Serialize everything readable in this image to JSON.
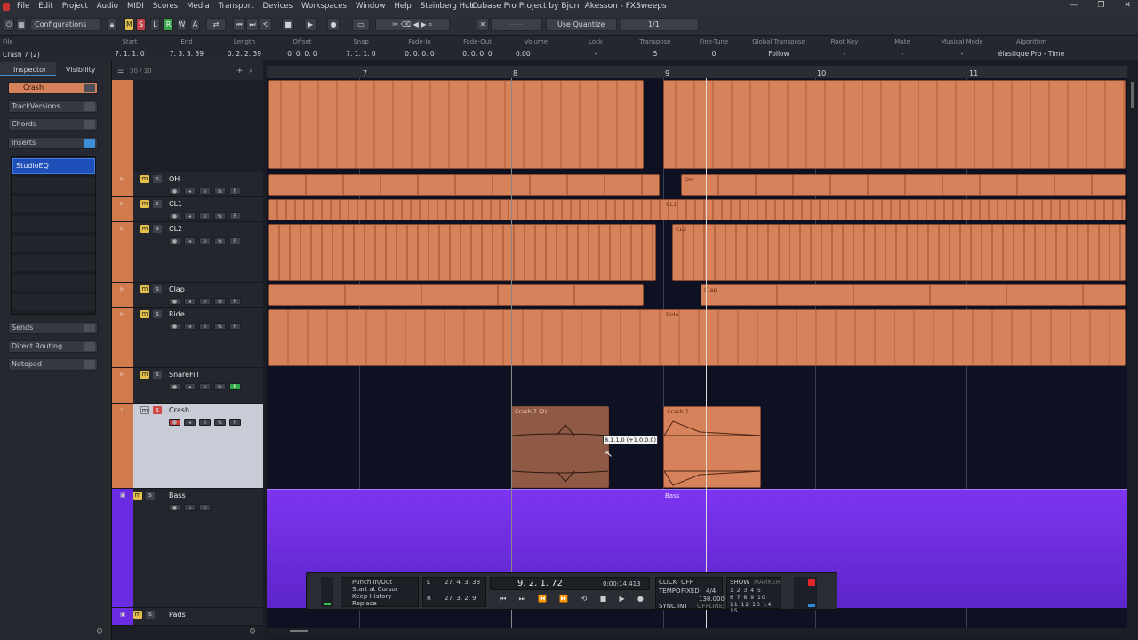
{
  "app": {
    "title": "Cubase Pro Project by Bjorn Akesson - FXSweeps"
  },
  "menu": [
    "File",
    "Edit",
    "Project",
    "Audio",
    "MIDI",
    "Scores",
    "Media",
    "Transport",
    "Devices",
    "Workspaces",
    "Window",
    "Help",
    "Steinberg Hub"
  ],
  "toolbar": {
    "configurations": "Configurations",
    "quantize": "Use Quantize",
    "grid": "1/1",
    "m": "M",
    "s": "S",
    "l": "L",
    "r": "R",
    "w": "W",
    "a": "A"
  },
  "infoline": {
    "selection": "Crash 7 (2)",
    "file_label": "File",
    "columns": [
      {
        "label": "Start",
        "value": "7. 1. 1. 0"
      },
      {
        "label": "End",
        "value": "7. 3. 3. 39"
      },
      {
        "label": "Length",
        "value": "0. 2. 2. 39"
      },
      {
        "label": "Offset",
        "value": "0. 0. 0. 0"
      },
      {
        "label": "Snap",
        "value": "7. 1. 1. 0"
      },
      {
        "label": "Fade-In",
        "value": "0. 0. 0. 0"
      },
      {
        "label": "Fade-Out",
        "value": "0. 0. 0. 0"
      },
      {
        "label": "Volume",
        "value": "0.00"
      },
      {
        "label": "Lock",
        "value": "-"
      },
      {
        "label": "Transpose",
        "value": "5"
      },
      {
        "label": "Fine-Tune",
        "value": "0"
      },
      {
        "label": "Global Transpose",
        "value": "Follow"
      },
      {
        "label": "Root Key",
        "value": "-"
      },
      {
        "label": "Mute",
        "value": "-"
      },
      {
        "label": "Musical Mode",
        "value": "-"
      },
      {
        "label": "Algorithm",
        "value": "élastique Pro - Time"
      }
    ]
  },
  "inspector": {
    "tab_inspector": "Inspector",
    "tab_visibility": "Visibility",
    "track_name": "Crash",
    "sections": [
      "TrackVersions",
      "Chords",
      "Inserts"
    ],
    "insert_slot": "StudioEQ",
    "lower_sections": [
      "Sends",
      "Direct Routing",
      "Notepad"
    ]
  },
  "tracklist": {
    "count": "30 / 30"
  },
  "tracks": [
    {
      "num": "3",
      "name": "OH"
    },
    {
      "num": "4",
      "name": "CL1"
    },
    {
      "num": "5",
      "name": "CL2"
    },
    {
      "num": "6",
      "name": "Clap"
    },
    {
      "num": "7",
      "name": "Ride"
    },
    {
      "num": "8",
      "name": "SnareFill"
    },
    {
      "num": "9",
      "name": "Crash"
    },
    {
      "num": "",
      "name": "Bass"
    },
    {
      "num": "",
      "name": "Pads"
    }
  ],
  "ruler": [
    "7",
    "8",
    "9",
    "10",
    "11"
  ],
  "events": {
    "oh": "OH",
    "cl1": "CL1",
    "cl2": "CL2",
    "clap": "Clap",
    "ride": "Ride",
    "crash_a": "Crash 7 (2)",
    "crash_b": "Crash 7",
    "bass": "Bass"
  },
  "tooltip": "8.1.1.0 (+1.0.0.0)",
  "transport": {
    "punch": "Punch In/Out",
    "start_cursor": "Start at Cursor",
    "keep_history": "Keep History",
    "replace": "Replace",
    "left_locator": "27. 4. 3. 38",
    "right_locator": "27. 3. 2. 9",
    "position": "9. 2. 1. 72",
    "time": "0:00:14.413",
    "click": "CLICK",
    "click_state": "OFF",
    "tempo": "TEMPO",
    "tempo_mode": "FIXED",
    "signature": "4/4",
    "bpm": "138.000",
    "sync": "SYNC",
    "sync_mode": "INT",
    "sync_state": "OFFLINE",
    "show": "SHOW",
    "marker": "MARKER",
    "markers": [
      "1",
      "2",
      "3",
      "4",
      "5",
      "6",
      "7",
      "8",
      "9",
      "10",
      "11",
      "12",
      "13",
      "14",
      "15"
    ]
  }
}
